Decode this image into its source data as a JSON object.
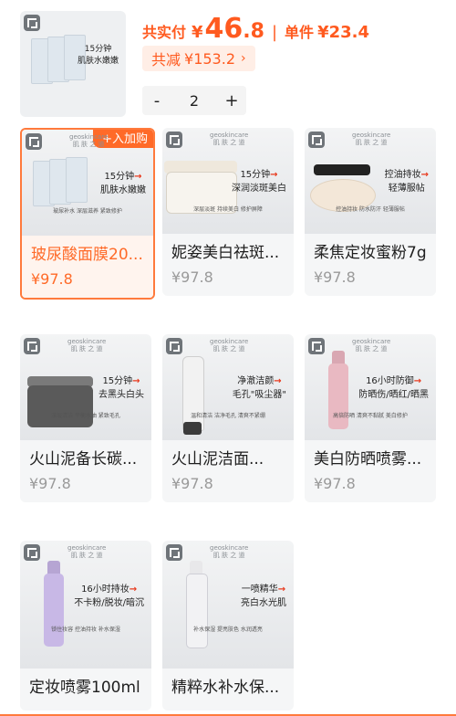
{
  "header": {
    "paid_label": "共实付",
    "currency": "¥",
    "paid_int": "46",
    "paid_dec": ".8",
    "separator": "|",
    "unit_label": "单件",
    "unit_price": "¥23.4",
    "discount_label": "共减",
    "discount_value": "¥153.2",
    "quantity": "2",
    "minus": "-",
    "plus": "+",
    "thumb_text": "15分钟",
    "thumb_text2": "肌肤水嫩嫩"
  },
  "products": [
    {
      "name": "玻尿酸面膜20...",
      "price": "¥97.8",
      "tag": "+入加购",
      "brand1": "geoskincare",
      "brand2": "肌 肤 之 道",
      "desc1": "15分钟",
      "desc2": "肌肤水嫩嫩",
      "feat": "玻尿补水 深层滋养 紧致修护"
    },
    {
      "name": "妮姿美白祛斑...",
      "price": "¥97.8",
      "brand1": "geoskincare",
      "brand2": "肌 肤 之 道",
      "desc1": "15分钟",
      "desc2": "深润淡斑美白",
      "feat": "深层淡斑 持续美白 修护屏障"
    },
    {
      "name": "柔焦定妆蜜粉7g",
      "price": "¥97.8",
      "brand1": "geoskincare",
      "brand2": "肌 肤 之 道",
      "desc1": "控油持妆",
      "desc2": "轻薄服帖",
      "feat": "控油持妆 防水防汗 轻薄服帖"
    },
    {
      "name": "火山泥备长碳...",
      "price": "¥97.8",
      "brand1": "geoskincare",
      "brand2": "肌 肤 之 道",
      "desc1": "15分钟",
      "desc2": "去黑头白头",
      "feat": "深层清洁 平衡水油 紧致毛孔"
    },
    {
      "name": "火山泥洁面...",
      "price": "¥97.8",
      "brand1": "geoskincare",
      "brand2": "肌 肤 之 道",
      "desc1": "净澈洁颜",
      "desc2": "毛孔\"吸尘器\"",
      "feat": "温和清洁 洁净毛孔 清爽不紧绷"
    },
    {
      "name": "美白防晒喷雾...",
      "price": "¥97.8",
      "brand1": "geoskincare",
      "brand2": "肌 肤 之 道",
      "desc1": "16小时防御",
      "desc2": "防晒伤/晒红/晒黑",
      "feat": "高倍防晒 清爽不黏腻 美白修护"
    },
    {
      "name": "定妆喷雾100ml",
      "price": "",
      "brand1": "geoskincare",
      "brand2": "肌 肤 之 道",
      "desc1": "16小时持妆",
      "desc2": "不卡粉/脱妆/暗沉",
      "feat": "锁住妆容 控油持妆 补水保湿"
    },
    {
      "name": "精粹水补水保...",
      "price": "",
      "brand1": "geoskincare",
      "brand2": "肌 肤 之 道",
      "desc1": "一喷精华",
      "desc2": "亮白水光肌",
      "feat": "补水保湿 提亮肤色 水润透亮"
    }
  ]
}
